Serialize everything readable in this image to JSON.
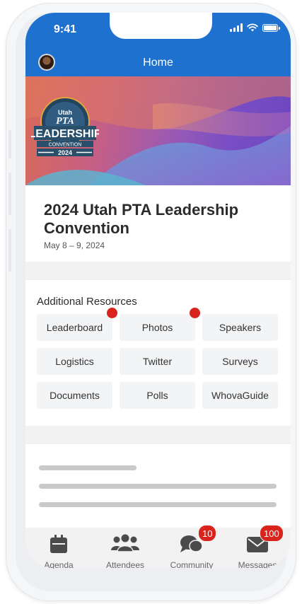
{
  "status_bar": {
    "time": "9:41"
  },
  "header": {
    "title": "Home"
  },
  "banner": {
    "logo_text": {
      "state": "Utah",
      "org": "PTA",
      "line1": "LEADERSHIP",
      "line2": "CONVENTION",
      "year": "2024"
    }
  },
  "event": {
    "title": "2024 Utah PTA Leadership Convention",
    "date": "May 8 – 9, 2024"
  },
  "resources": {
    "heading": "Additional Resources",
    "items": [
      {
        "label": "Leaderboard",
        "has_dot": true
      },
      {
        "label": "Photos",
        "has_dot": true
      },
      {
        "label": "Speakers",
        "has_dot": false
      },
      {
        "label": "Logistics",
        "has_dot": false
      },
      {
        "label": "Twitter",
        "has_dot": false
      },
      {
        "label": "Surveys",
        "has_dot": false
      },
      {
        "label": "Documents",
        "has_dot": false
      },
      {
        "label": "Polls",
        "has_dot": false
      },
      {
        "label": "WhovaGuide",
        "has_dot": false
      }
    ]
  },
  "bottom_nav": {
    "items": [
      {
        "label": "Agenda",
        "icon": "calendar-icon"
      },
      {
        "label": "Attendees",
        "icon": "people-icon"
      },
      {
        "label": "Community",
        "icon": "chat-icon",
        "badge": "10"
      },
      {
        "label": "Messages",
        "icon": "envelope-icon",
        "badge": "100"
      }
    ]
  },
  "colors": {
    "primary": "#1f71cf",
    "badge": "#d9231d"
  }
}
